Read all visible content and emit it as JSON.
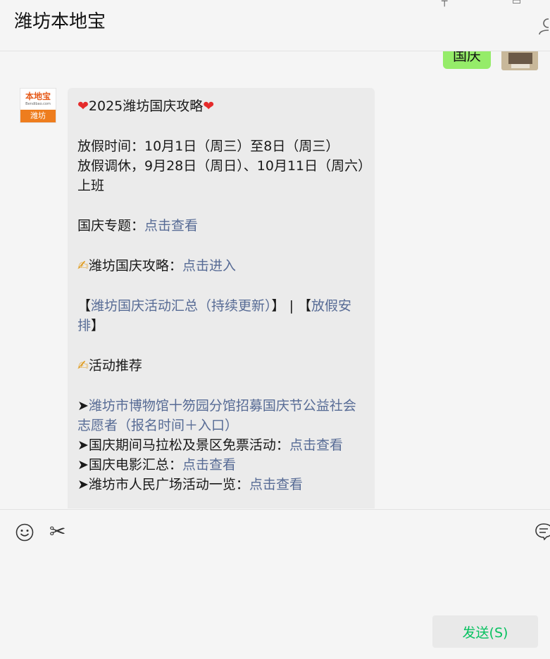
{
  "header": {
    "title": "潍坊本地宝"
  },
  "sent_message": {
    "text": "国庆"
  },
  "received_avatar": {
    "logo_top": "本地宝",
    "logo_sub": "Bendibao.com",
    "logo_band": "潍坊"
  },
  "message": {
    "heading_text": "2025潍坊国庆攻略",
    "heart": "❤",
    "pen": "✍",
    "holiday_time": "放假时间：10月1日（周三）至8日（周三）",
    "adjusted_work": "放假调休，9月28日（周日）、10月11日（周六）上班",
    "special_label": "国庆专题：",
    "special_link": "点击查看",
    "guide_label": "潍坊国庆攻略：",
    "guide_link": "点击进入",
    "bracket_open": "【",
    "activity_link": "潍坊国庆活动汇总（持续更新）",
    "bracket_sep": "】 | 【",
    "schedule_link": "放假安排",
    "bracket_close": "】",
    "recommend": "活动推荐",
    "arrow": "➤",
    "item1_link": "潍坊市博物馆十笏园分馆招募国庆节公益社会志愿者（报名时间＋入口）",
    "item2_label": "国庆期间马拉松及景区免票活动：",
    "item2_link": "点击查看",
    "item3_label": "国庆电影汇总：",
    "item3_link": "点击查看",
    "item4_label": "潍坊市人民广场活动一览：",
    "item4_link": "点击查看"
  },
  "input": {
    "send_label": "发送(S)"
  }
}
